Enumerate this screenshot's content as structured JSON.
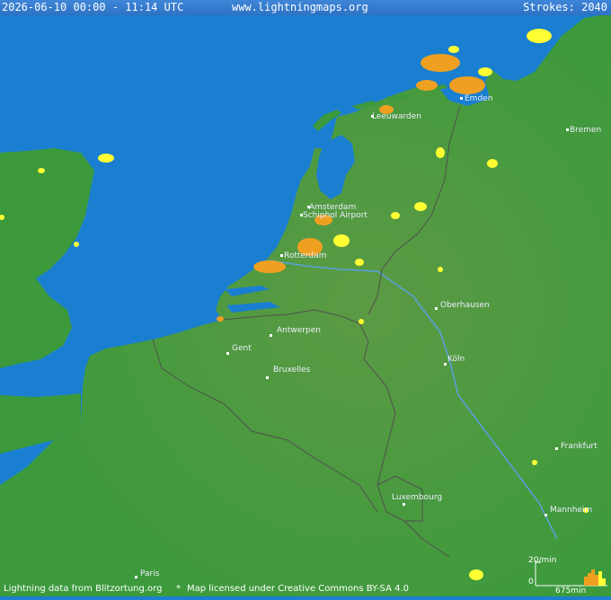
{
  "header": {
    "time_range": "2026-06-10 00:00 - 11:14 UTC",
    "site": "www.lightningmaps.org",
    "strokes": "Strokes: 2040"
  },
  "footer": {
    "credit_data": "Lightning data from Blitzortung.org",
    "separator": "*",
    "credit_map": "Map licensed under Creative Commons BY-SA 4.0"
  },
  "cities": [
    {
      "name": "Leeuwarden"
    },
    {
      "name": "Emden"
    },
    {
      "name": "Bremen"
    },
    {
      "name": "Amsterdam"
    },
    {
      "name": "Schiphol Airport"
    },
    {
      "name": "Rotterdam"
    },
    {
      "name": "Oberhausen"
    },
    {
      "name": "Antwerpen"
    },
    {
      "name": "Gent"
    },
    {
      "name": "Bruxelles"
    },
    {
      "name": "Köln"
    },
    {
      "name": "Frankfurt"
    },
    {
      "name": "Luxembourg"
    },
    {
      "name": "Mannheim"
    },
    {
      "name": "Paris"
    }
  ],
  "histogram": {
    "rate_label": "20/min",
    "zero_label": "0",
    "span_label": "675min"
  },
  "colors": {
    "sea": "#1a7fd0",
    "land": "#3c9a3c",
    "strike_recent": "#ffff33",
    "strike_older": "#f0a020"
  }
}
